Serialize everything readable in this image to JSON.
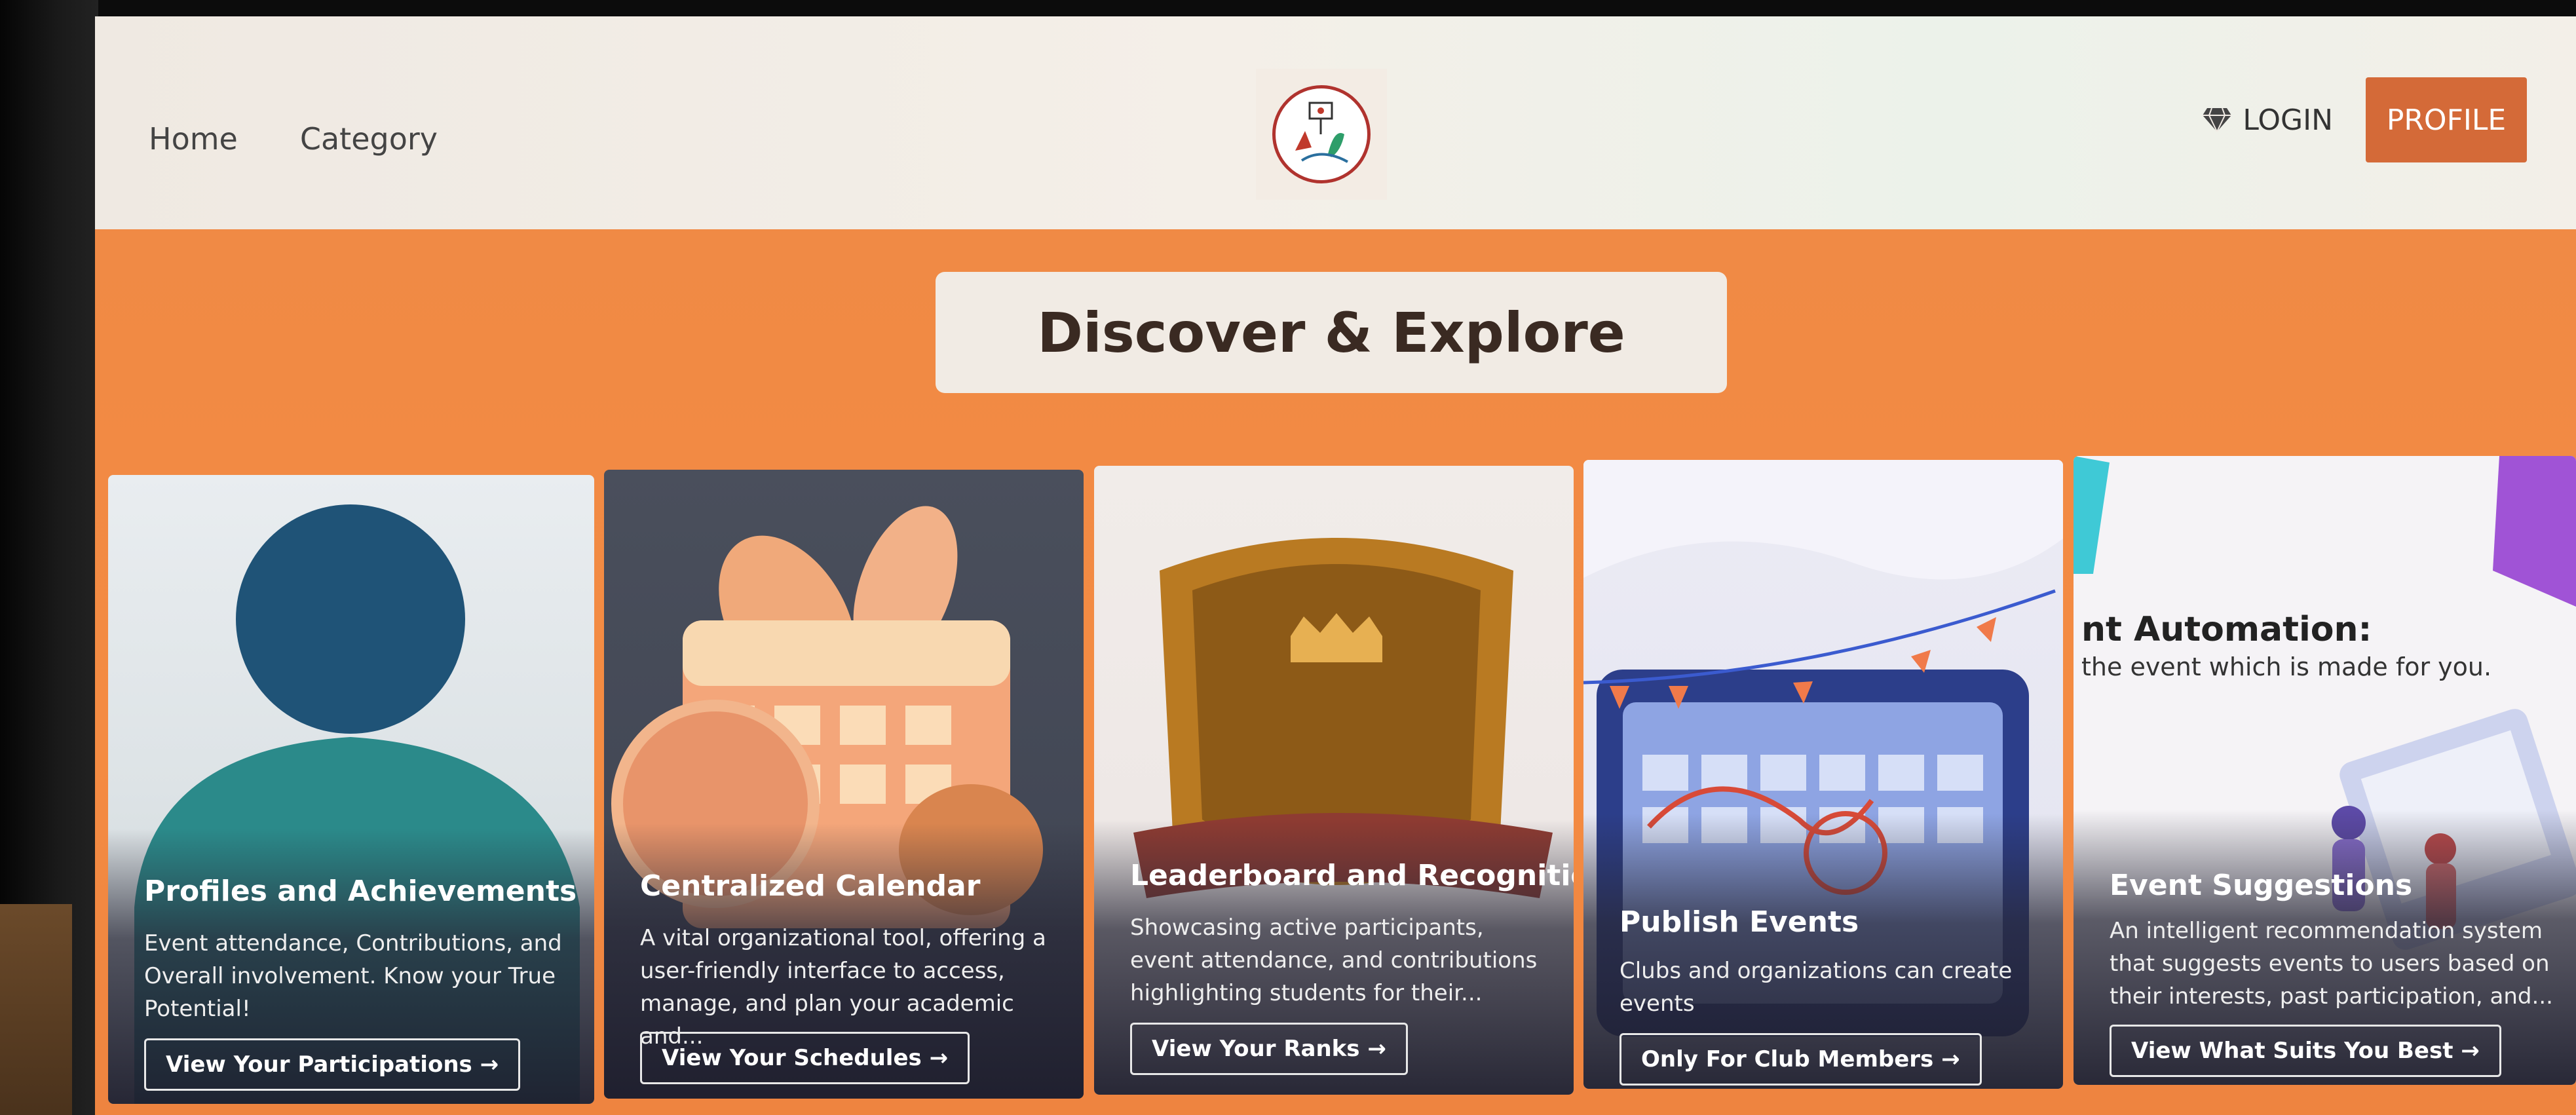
{
  "nav": {
    "home": "Home",
    "category": "Category",
    "login": "LOGIN",
    "profile": "PROFILE"
  },
  "hero": {
    "title": "Discover & Explore"
  },
  "cards": [
    {
      "title": "Profiles and Achievements",
      "description": "Event attendance, Contributions, and Overall involvement. Know your True Potential!",
      "button": "View Your Participations →"
    },
    {
      "title": "Centralized Calendar",
      "description": "A vital organizational tool, offering a user-friendly interface to access, manage, and plan your academic and...",
      "button": "View Your Schedules →"
    },
    {
      "title": "Leaderboard and Recognition",
      "description": "Showcasing active participants, event attendance, and contributions highlighting students for their...",
      "button": "View Your Ranks →"
    },
    {
      "title": "Publish Events",
      "description": "Clubs and organizations can create events",
      "button": "Only For Club Members →"
    },
    {
      "heading_partial": "nt Automation:",
      "subheading_partial": "the event which is made for you.",
      "title": "Event Suggestions",
      "description": "An intelligent recommendation system that suggests events to users based on their interests, past participation, and...",
      "button": "View What Suits You Best →"
    }
  ],
  "colors": {
    "accent": "#d46a38",
    "hero_bg": "#f08a45",
    "nav_bg": "#f1ebe4"
  }
}
